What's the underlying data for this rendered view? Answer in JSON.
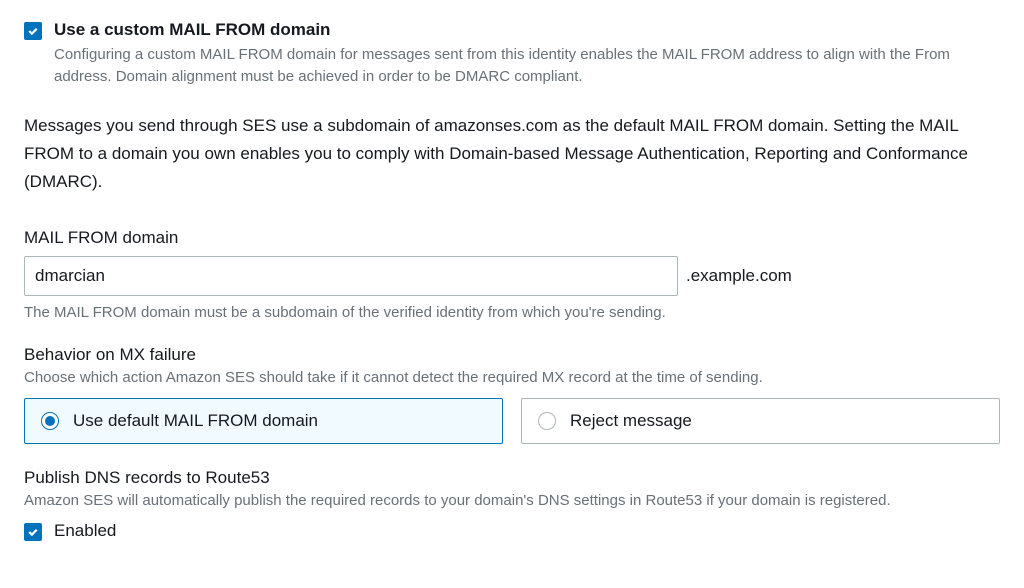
{
  "custom_mail_from": {
    "label": "Use a custom MAIL FROM domain",
    "description": "Configuring a custom MAIL FROM domain for messages sent from this identity enables the MAIL FROM address to align with the From address. Domain alignment must be achieved in order to be DMARC compliant.",
    "checked": true
  },
  "explain": "Messages you send through SES use a subdomain of amazonses.com as the default MAIL FROM domain. Setting the MAIL FROM to a domain you own enables you to comply with Domain-based Message Authentication, Reporting and Conformance (DMARC).",
  "mail_from_domain": {
    "label": "MAIL FROM domain",
    "value": "dmarcian",
    "suffix": ".example.com",
    "hint": "The MAIL FROM domain must be a subdomain of the verified identity from which you're sending."
  },
  "mx_behavior": {
    "label": "Behavior on MX failure",
    "description": "Choose which action Amazon SES should take if it cannot detect the required MX record at the time of sending.",
    "options": [
      {
        "label": "Use default MAIL FROM domain",
        "selected": true
      },
      {
        "label": "Reject message",
        "selected": false
      }
    ]
  },
  "route53": {
    "label": "Publish DNS records to Route53",
    "description": "Amazon SES will automatically publish the required records to your domain's DNS settings in Route53 if your domain is registered.",
    "checkbox_label": "Enabled",
    "checked": true
  }
}
